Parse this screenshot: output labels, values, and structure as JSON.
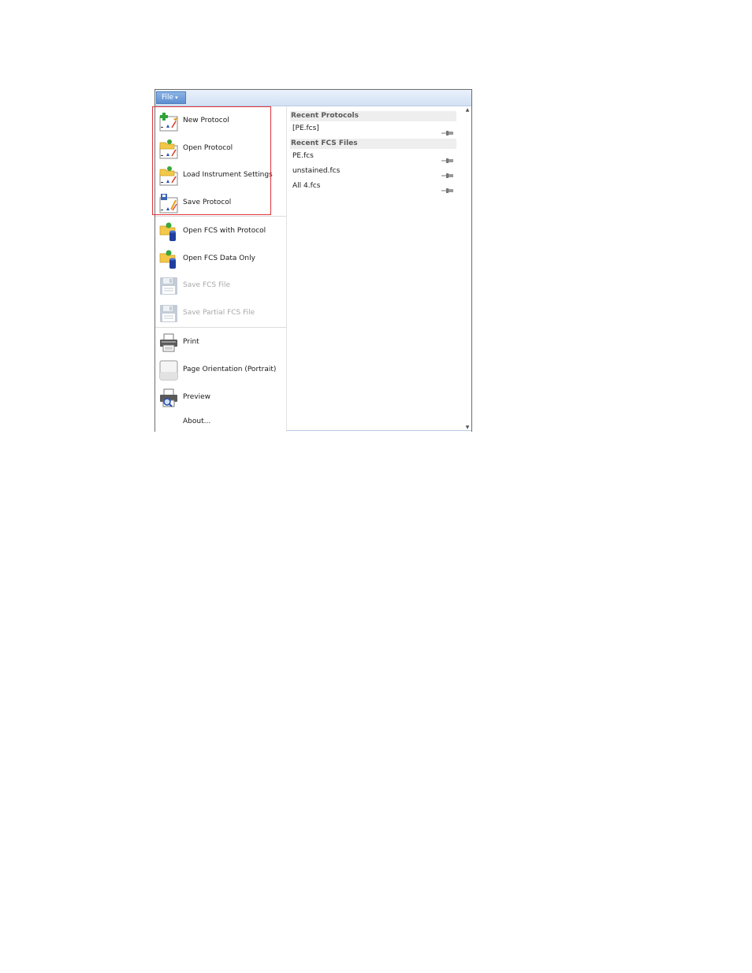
{
  "menubar": {
    "file_label": "File",
    "file_arrow": "▾"
  },
  "left_menu": {
    "group1": [
      {
        "label": "New Protocol",
        "icon": "new-protocol-icon",
        "enabled": true
      },
      {
        "label": "Open Protocol",
        "icon": "open-protocol-icon",
        "enabled": true
      },
      {
        "label": "Load Instrument Settings",
        "icon": "load-settings-icon",
        "enabled": true
      },
      {
        "label": "Save Protocol",
        "icon": "save-protocol-icon",
        "enabled": true
      }
    ],
    "group2": [
      {
        "label": "Open FCS with Protocol",
        "icon": "open-fcs-protocol-icon",
        "enabled": true
      },
      {
        "label": "Open FCS Data Only",
        "icon": "open-fcs-data-icon",
        "enabled": true
      },
      {
        "label": "Save FCS File",
        "icon": "floppy-icon",
        "enabled": false
      },
      {
        "label": "Save Partial FCS File",
        "icon": "floppy-icon",
        "enabled": false
      }
    ],
    "group3": [
      {
        "label": "Print",
        "icon": "printer-icon",
        "enabled": true
      },
      {
        "label": "Page Orientation (Portrait)",
        "icon": "page-orientation-icon",
        "enabled": true
      },
      {
        "label": "Preview",
        "icon": "print-preview-icon",
        "enabled": true
      },
      {
        "label": "About...",
        "icon": "",
        "enabled": true
      }
    ]
  },
  "recent": {
    "protocols_header": "Recent Protocols",
    "protocols": [
      "[PE.fcs]"
    ],
    "fcs_header": "Recent FCS Files",
    "fcs_files": [
      "PE.fcs",
      "unstained.fcs",
      "All 4.fcs"
    ]
  },
  "colors": {
    "highlight_box": "#e0353b",
    "file_button": "#6b9ad6",
    "disabled_text": "#a8a8a8"
  }
}
